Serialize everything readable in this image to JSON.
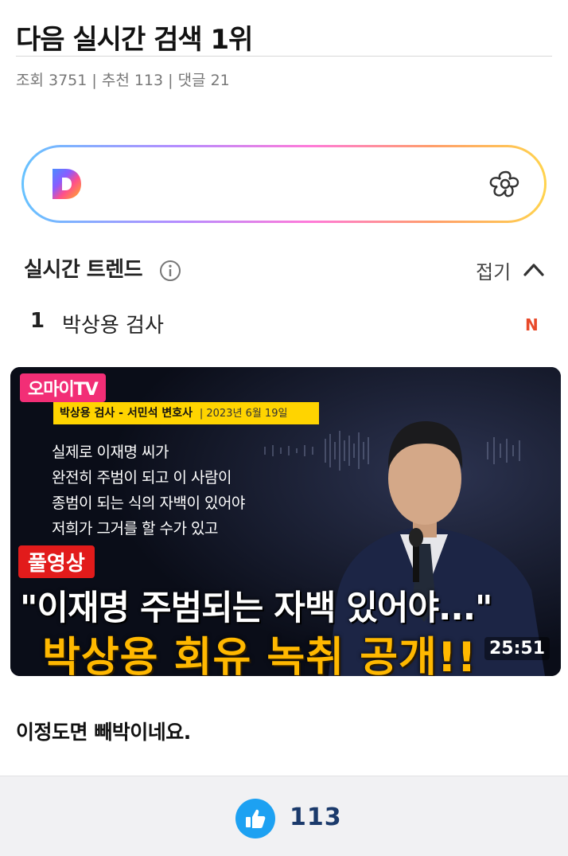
{
  "post": {
    "title": "다음 실시간 검색 1위",
    "meta": "조회 3751 | 추천 113 | 댓글 21",
    "comment_text": "이정도면 빼박이네요."
  },
  "search": {
    "logo_icon": "daum-logo",
    "right_icon": "flower-icon"
  },
  "trends": {
    "header": "실시간 트렌드",
    "fold_label": "접기",
    "items": [
      {
        "rank": "1",
        "keyword": "박상용 검사",
        "badge": "N"
      }
    ]
  },
  "video": {
    "channel": "오마이TV",
    "caption_title": "박상용 검사 - 서민석 변호사",
    "caption_date": "2023년 6월 19일",
    "quote_lines": [
      "실제로 이재명 씨가",
      "완전히 주범이 되고 이 사람이",
      "종범이 되는 식의 자백이 있어야",
      "저희가 그거를 할 수가 있고"
    ],
    "tag": "풀영상",
    "headline_1": "\"이재명 주범되는 자백 있어야...\"",
    "headline_2": "박상용 회유 녹취 공개!!",
    "duration": "25:51"
  },
  "footer": {
    "like_icon": "thumbs-up-icon",
    "like_count": "113"
  },
  "colors": {
    "accent_blue": "#1da1f2",
    "new_badge": "#e8492a",
    "headline_yellow": "#ffb800",
    "channel_pink": "#f22e76"
  }
}
